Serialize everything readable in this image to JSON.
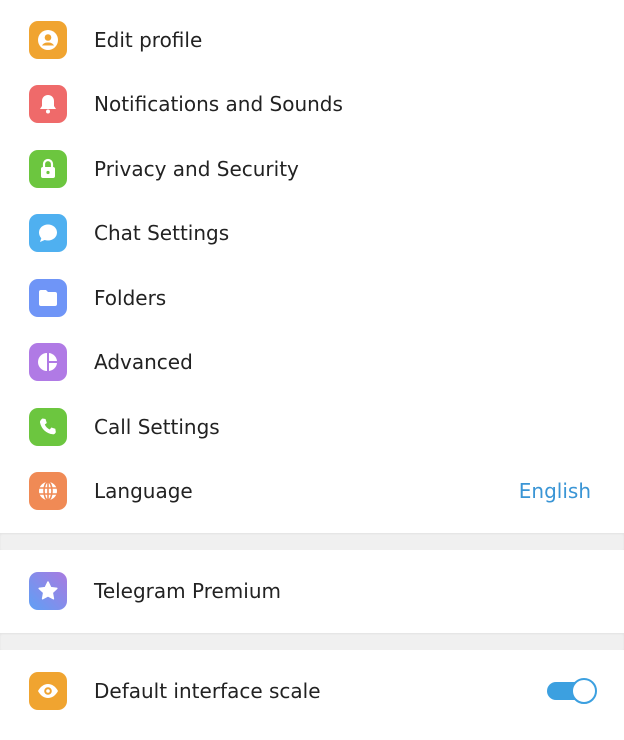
{
  "menu": {
    "items": [
      {
        "label": "Edit profile",
        "icon": "profile-icon",
        "color": "#f0a430"
      },
      {
        "label": "Notifications and Sounds",
        "icon": "bell-icon",
        "color": "#ef6a6a"
      },
      {
        "label": "Privacy and Security",
        "icon": "lock-icon",
        "color": "#6cc63f"
      },
      {
        "label": "Chat Settings",
        "icon": "chat-bubble-icon",
        "color": "#4fb0f0"
      },
      {
        "label": "Folders",
        "icon": "folder-icon",
        "color": "#6f95f7"
      },
      {
        "label": "Advanced",
        "icon": "pie-chart-icon",
        "color": "#b07ae5"
      },
      {
        "label": "Call Settings",
        "icon": "phone-icon",
        "color": "#6cc63f"
      },
      {
        "label": "Language",
        "icon": "globe-icon",
        "color": "#f08a55",
        "value": "English"
      }
    ]
  },
  "premium": {
    "label": "Telegram Premium",
    "icon": "star-icon",
    "color_start": "#a97ae0",
    "color_end": "#5fa0f5"
  },
  "scale": {
    "label": "Default interface scale",
    "icon": "eye-icon",
    "color": "#f0a430",
    "toggle_on": true,
    "toggle_color": "#3ca0e0"
  }
}
